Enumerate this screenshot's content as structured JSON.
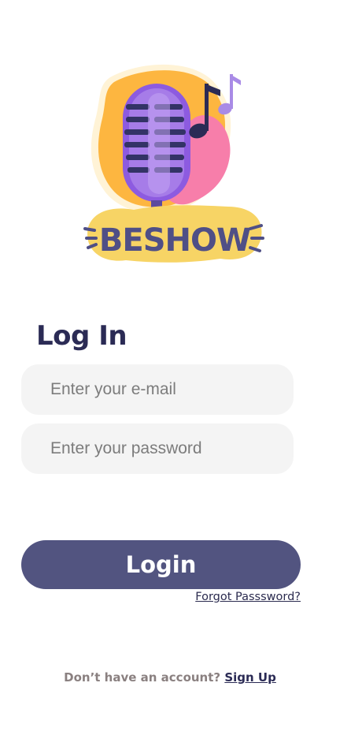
{
  "logo": {
    "text": "BESHOW",
    "colors": {
      "blob_orange": "#fdb640",
      "blob_pink": "#f77eaa",
      "mic_purple": "#8d5be0",
      "grille_dark": "#333366",
      "note_dark": "#2b2b55",
      "note_light": "#a98be6",
      "banner_yellow": "#f7d465",
      "letters": "#4f4f86"
    }
  },
  "page": {
    "title": "Log In"
  },
  "form": {
    "email_placeholder": "Enter your e-mail",
    "password_placeholder": "Enter your password",
    "login_label": "Login",
    "forgot_label": "Forgot Passsword?"
  },
  "footer": {
    "prompt": "Don’t have an account?",
    "signup_label": "Sign Up"
  },
  "colors": {
    "primary": "#525480",
    "title": "#2b2b55",
    "input_bg": "#f4f4f4",
    "muted": "#8a8080"
  }
}
